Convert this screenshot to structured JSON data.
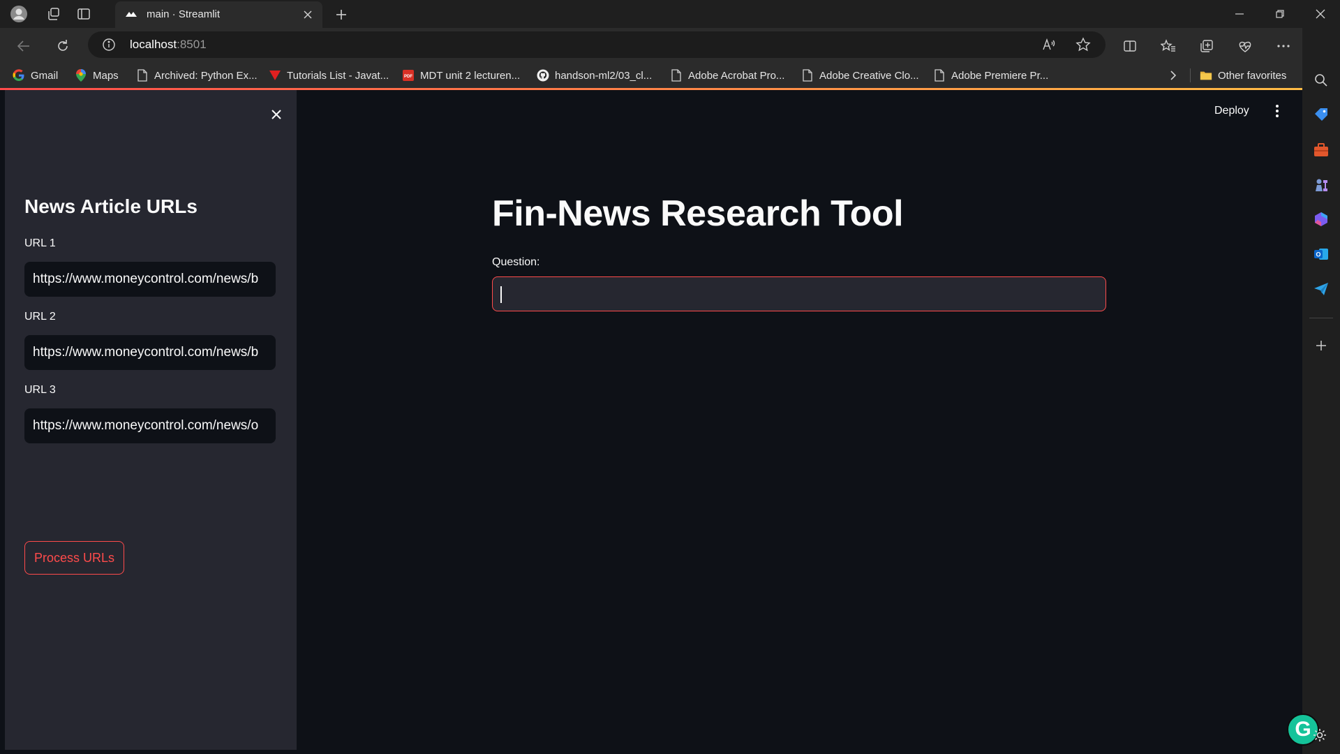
{
  "browser": {
    "tab_title": "main · Streamlit",
    "url_host": "localhost",
    "url_port": ":8501",
    "bookmarks": [
      {
        "label": "Gmail",
        "icon": "google-icon"
      },
      {
        "label": "Maps",
        "icon": "maps-icon"
      },
      {
        "label": "Archived: Python Ex...",
        "icon": "page-icon"
      },
      {
        "label": "Tutorials List - Javat...",
        "icon": "javatpoint-icon"
      },
      {
        "label": "MDT unit 2 lecturen...",
        "icon": "pdf-icon"
      },
      {
        "label": "handson-ml2/03_cl...",
        "icon": "github-icon"
      },
      {
        "label": "Adobe Acrobat Pro...",
        "icon": "page-icon"
      },
      {
        "label": "Adobe Creative Clo...",
        "icon": "page-icon"
      },
      {
        "label": "Adobe Premiere Pr...",
        "icon": "page-icon"
      }
    ],
    "other_favorites": "Other favorites"
  },
  "app": {
    "deploy_label": "Deploy",
    "title": "Fin-News Research Tool",
    "question_label": "Question:",
    "question_value": ""
  },
  "sidebar": {
    "title": "News Article URLs",
    "urls": [
      {
        "label": "URL 1",
        "value": "https://www.moneycontrol.com/news/b"
      },
      {
        "label": "URL 2",
        "value": "https://www.moneycontrol.com/news/b"
      },
      {
        "label": "URL 3",
        "value": "https://www.moneycontrol.com/news/o"
      }
    ],
    "process_button": "Process URLs"
  },
  "colors": {
    "streamlit_accent": "#ff4b4b",
    "app_background": "#0e1117",
    "sidebar_background": "#262730"
  }
}
